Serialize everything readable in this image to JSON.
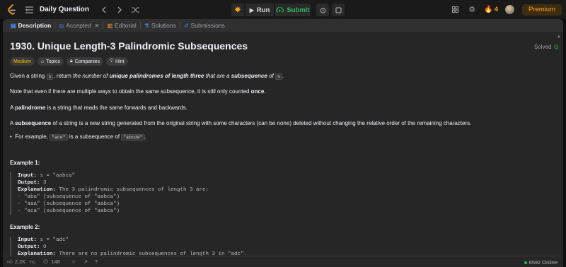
{
  "nav": {
    "title": "Daily Question",
    "run_label": "Run",
    "submit_label": "Submit",
    "streak_count": "4",
    "premium_label": "Premium"
  },
  "tabs": [
    {
      "label": "Description",
      "icon": "description-icon"
    },
    {
      "label": "Accepted",
      "icon": "accepted-icon"
    },
    {
      "label": "Editorial",
      "icon": "editorial-icon"
    },
    {
      "label": "Solutions",
      "icon": "solutions-icon"
    },
    {
      "label": "Submissions",
      "icon": "submissions-icon"
    }
  ],
  "problem": {
    "title": "1930. Unique Length-3 Palindromic Subsequences",
    "status": "Solved",
    "difficulty": "Medium",
    "topics_label": "Topics",
    "companies_label": "Companies",
    "hint_label": "Hint",
    "p1": {
      "a": "Given a string ",
      "code": "s",
      "b": ", return ",
      "c": "the number of ",
      "d": "unique palindromes of length three",
      "e": " that are a ",
      "f": "subsequence",
      "g": " of ",
      "h": "s",
      "i": "."
    },
    "p2": {
      "a": "Note that even if there are multiple ways to obtain the same subsequence, it is still only counted ",
      "b": "once",
      "c": "."
    },
    "p3": {
      "a": "A ",
      "b": "palindrome",
      "c": " is a string that reads the same forwards and backwards."
    },
    "p4": {
      "a": "A ",
      "b": "subsequence",
      "c": " of a string is a new string generated from the original string with some characters (can be none) deleted without changing the relative order of the remaining characters."
    },
    "bullet": {
      "a": "For example, ",
      "code1": "\"ace\"",
      "b": " is a subsequence of ",
      "code2": "\"abcde\"",
      "c": "."
    }
  },
  "examples": [
    {
      "title": "Example 1:",
      "input_label": "Input:",
      "input": " s = \"aabca\"",
      "output_label": "Output:",
      "output": " 3",
      "explanation_label": "Explanation:",
      "explanation": " The 3 palindromic subsequences of length 3 are:",
      "lines": [
        "- \"aba\" (subsequence of \"aabca\")",
        "- \"aaa\" (subsequence of \"aabca\")",
        "- \"aca\" (subsequence of \"aabca\")"
      ]
    },
    {
      "title": "Example 2:",
      "input_label": "Input:",
      "input": " s = \"adc\"",
      "output_label": "Output:",
      "output": " 0",
      "explanation_label": "Explanation:",
      "explanation": " There are no palindromic subsequences of length 3 in \"adc\"."
    }
  ],
  "bottom": {
    "likes": "2.2K",
    "comments": "148",
    "online": "6592 Online"
  },
  "colors": {
    "accent": "#ffa116",
    "success": "#2cbb5d",
    "medium": "#ffb800"
  }
}
